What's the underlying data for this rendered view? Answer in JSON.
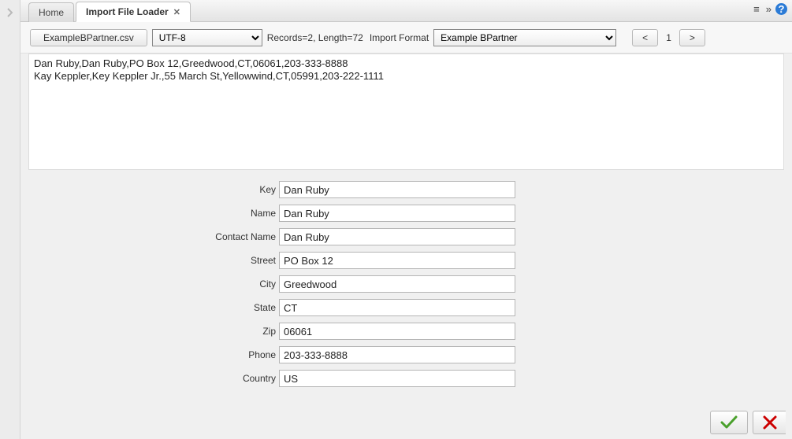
{
  "tabs": {
    "home": "Home",
    "active": "Import File Loader"
  },
  "toolbar": {
    "file_button": "ExampleBPartner.csv",
    "encoding": "UTF-8",
    "records_label": "Records=2, Length=72",
    "import_format_label": "Import Format",
    "format_value": "Example BPartner",
    "prev": "<",
    "page": "1",
    "next": ">"
  },
  "preview_lines": [
    "Dan Ruby,Dan Ruby,PO Box 12,Greedwood,CT,06061,203-333-8888",
    "Kay Keppler,Key Keppler Jr.,55 March St,Yellowwind,CT,05991,203-222-1111"
  ],
  "fields": [
    {
      "label": "Key",
      "value": "Dan Ruby"
    },
    {
      "label": "Name",
      "value": "Dan Ruby"
    },
    {
      "label": "Contact Name",
      "value": "Dan Ruby"
    },
    {
      "label": "Street",
      "value": "PO Box 12"
    },
    {
      "label": "City",
      "value": "Greedwood"
    },
    {
      "label": "State",
      "value": "CT"
    },
    {
      "label": "Zip",
      "value": "06061"
    },
    {
      "label": "Phone",
      "value": "203-333-8888"
    },
    {
      "label": "Country",
      "value": "US"
    }
  ]
}
